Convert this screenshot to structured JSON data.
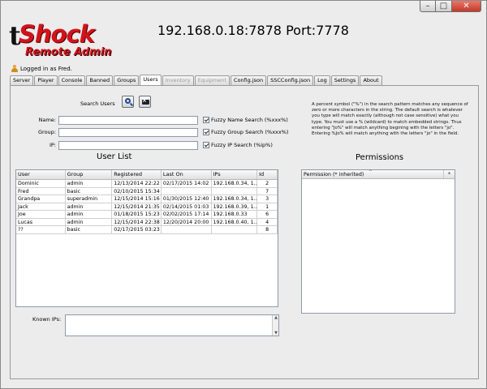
{
  "window": {
    "controls": {
      "minimize": "–",
      "maximize": "□",
      "close": "✕"
    }
  },
  "logo": {
    "letter": "t",
    "word": "Shock",
    "sub": "Remote Admin"
  },
  "header": {
    "address": "192.168.0.18:7878  Port:7778"
  },
  "status": {
    "logged_in": "Logged in as Fred."
  },
  "tabs": [
    {
      "label": "Server",
      "state": "normal"
    },
    {
      "label": "Player",
      "state": "normal"
    },
    {
      "label": "Console",
      "state": "normal"
    },
    {
      "label": "Banned",
      "state": "normal"
    },
    {
      "label": "Groups",
      "state": "normal"
    },
    {
      "label": "Users",
      "state": "active"
    },
    {
      "label": "Inventory",
      "state": "disabled"
    },
    {
      "label": "Equipment",
      "state": "disabled"
    },
    {
      "label": "Config.json",
      "state": "normal"
    },
    {
      "label": "SSCConfig.json",
      "state": "normal"
    },
    {
      "label": "Log",
      "state": "normal"
    },
    {
      "label": "Settings",
      "state": "normal"
    },
    {
      "label": "About",
      "state": "normal"
    }
  ],
  "search": {
    "label": "Search Users",
    "search_icon": "search-icon",
    "clear_icon": "clear-icon",
    "fields": [
      {
        "label": "Name:",
        "value": "",
        "fuzzy_label": "Fuzzy Name Search (%xxx%)",
        "fuzzy_checked": true
      },
      {
        "label": "Group:",
        "value": "",
        "fuzzy_label": "Fuzzy Group Search (%xxx%)",
        "fuzzy_checked": true
      },
      {
        "label": "IP:",
        "value": "",
        "fuzzy_label": "Fuzzy IP Search (%ip%)",
        "fuzzy_checked": true
      }
    ],
    "help_text": "A percent symbol (\"%\") in the search pattern matches any sequence of zero or more characters in the string. The default search is whatever you type will match exactly (although not case sensitive) what you type. You must use a % (wildcard) to match embedded strings. Thus entering \"Jo%\" will match anything begining with the letters \"jo\". Entering %Jo% will match anything with the letters \"jo\" in the field."
  },
  "user_list": {
    "title": "User List",
    "columns": [
      "User",
      "Group",
      "Registered",
      "Last On",
      "IPs",
      "Id"
    ],
    "rows": [
      [
        "Dominic",
        "admin",
        "12/13/2014 22:22",
        "02/17/2015 14:02",
        "192.168.0.34, 1...",
        "2"
      ],
      [
        "Fred",
        "basic",
        "02/10/2015 15:34",
        "",
        "",
        "7"
      ],
      [
        "Grandpa",
        "superadmin",
        "12/15/2014 15:16",
        "01/30/2015 12:40",
        "192.168.0.34, 1...",
        "3"
      ],
      [
        "Jack",
        "admin",
        "12/15/2014 21:35",
        "02/14/2015 01:03",
        "192.168.0.39, 1...",
        "1"
      ],
      [
        "Joe",
        "admin",
        "01/18/2015 15:23",
        "02/02/2015 17:14",
        "192.168.0.33",
        "6"
      ],
      [
        "Lucas",
        "admin",
        "12/15/2014 22:38",
        "12/20/2014 20:00",
        "192.168.0.40, 1...",
        "4"
      ],
      [
        "??",
        "basic",
        "02/17/2015 03:23",
        "",
        "",
        "8"
      ]
    ]
  },
  "permissions": {
    "title": "Permissions",
    "column": "Permission (* inherited)",
    "sort_indicator": "^",
    "corner": "*"
  },
  "known_ips": {
    "label": "Known IPs:",
    "value": ""
  },
  "colors": {
    "brand_red": "#d1141b",
    "window_bg": "#ececec"
  }
}
